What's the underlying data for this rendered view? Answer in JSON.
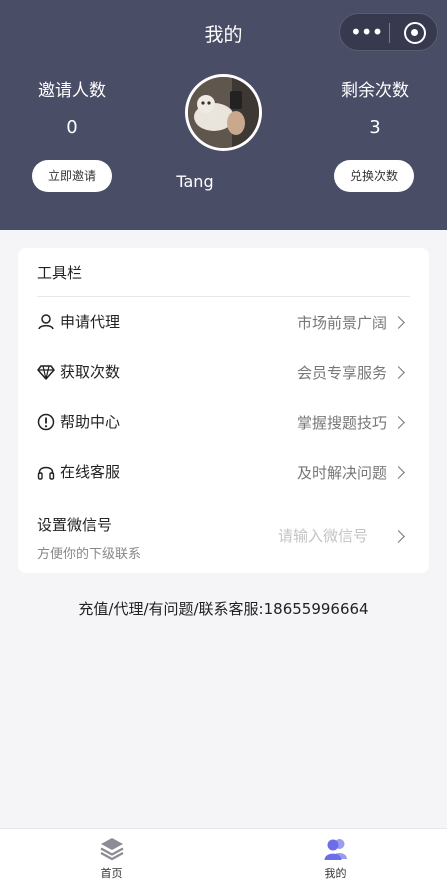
{
  "header": {
    "title": "我的",
    "capsule": {
      "more_icon": "more-dots-icon",
      "close_icon": "target-icon"
    },
    "invites": {
      "label": "邀请人数",
      "value": "0",
      "button": "立即邀请"
    },
    "remaining": {
      "label": "剩余次数",
      "value": "3",
      "button": "兑换次数"
    },
    "user": {
      "name": "Tang"
    }
  },
  "toolbar": {
    "title": "工具栏",
    "items": [
      {
        "icon": "user-icon",
        "label": "申请代理",
        "hint": "市场前景广阔"
      },
      {
        "icon": "diamond-icon",
        "label": "获取次数",
        "hint": "会员专享服务"
      },
      {
        "icon": "info-circle-icon",
        "label": "帮助中心",
        "hint": "掌握搜题技巧"
      },
      {
        "icon": "headset-icon",
        "label": "在线客服",
        "hint": "及时解决问题"
      }
    ],
    "wechat": {
      "title": "设置微信号",
      "subtitle": "方便你的下级联系",
      "placeholder": "请输入微信号"
    }
  },
  "contact": "充值/代理/有问题/联系客服:18655996664",
  "tabbar": {
    "items": [
      {
        "label": "首页",
        "icon": "layers-icon"
      },
      {
        "label": "我的",
        "icon": "users-icon",
        "active": true
      }
    ],
    "active_color": "#6b6ee8"
  },
  "colors": {
    "header_bg": "#4a4d66",
    "page_bg": "#f5f5f7"
  }
}
